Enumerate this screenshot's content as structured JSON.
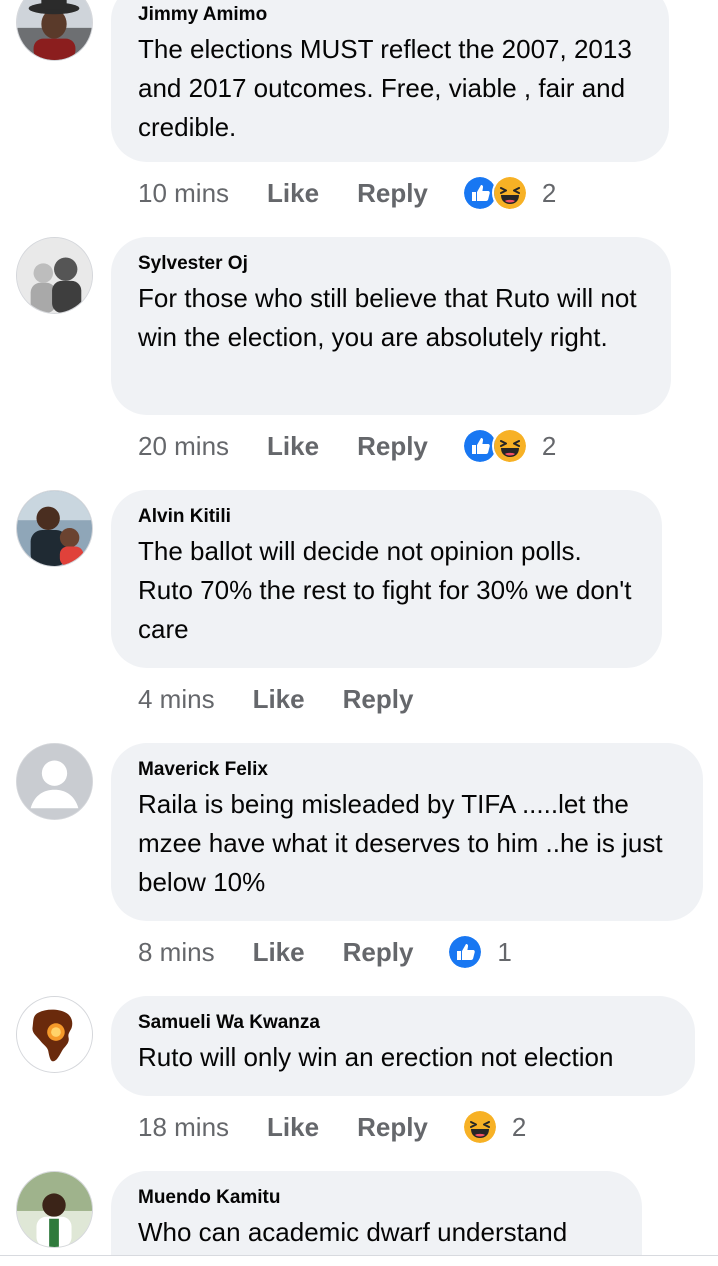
{
  "colors": {
    "bubble": "#f0f2f5",
    "like_blue": "#1877f2",
    "haha_yellow": "#f7b125",
    "meta_text": "#65676b"
  },
  "labels": {
    "like": "Like",
    "reply": "Reply"
  },
  "comments": [
    {
      "author": "Jimmy Amimo",
      "text": "The elections MUST reflect the 2007, 2013 and 2017 outcomes.  Free, viable , fair and credible.",
      "time": "10 mins",
      "reactions": [
        "like-icon",
        "haha-icon"
      ],
      "reaction_count": "2"
    },
    {
      "author": "Sylvester Oj",
      "text": "For those who still believe that Ruto will not win the election, you are absolutely right.",
      "time": "20 mins",
      "reactions": [
        "like-icon",
        "haha-icon"
      ],
      "reaction_count": "2"
    },
    {
      "author": "Alvin Kitili",
      "text": "The ballot will decide not opinion polls. Ruto 70% the rest to fight for 30% we don't care",
      "time": "4 mins",
      "reactions": [],
      "reaction_count": ""
    },
    {
      "author": "Maverick Felix",
      "text": "Raila is being misleaded by TIFA .....let the mzee have what it deserves to him ..he is just below 10%",
      "time": "8 mins",
      "reactions": [
        "like-icon"
      ],
      "reaction_count": "1"
    },
    {
      "author": "Samueli Wa Kwanza",
      "text": "Ruto will only win an erection not election",
      "time": "18 mins",
      "reactions": [
        "haha-icon"
      ],
      "reaction_count": "2"
    },
    {
      "author": "Muendo Kamitu",
      "text": "Who can academic dwarf understand",
      "time": "",
      "reactions": [],
      "reaction_count": ""
    }
  ]
}
